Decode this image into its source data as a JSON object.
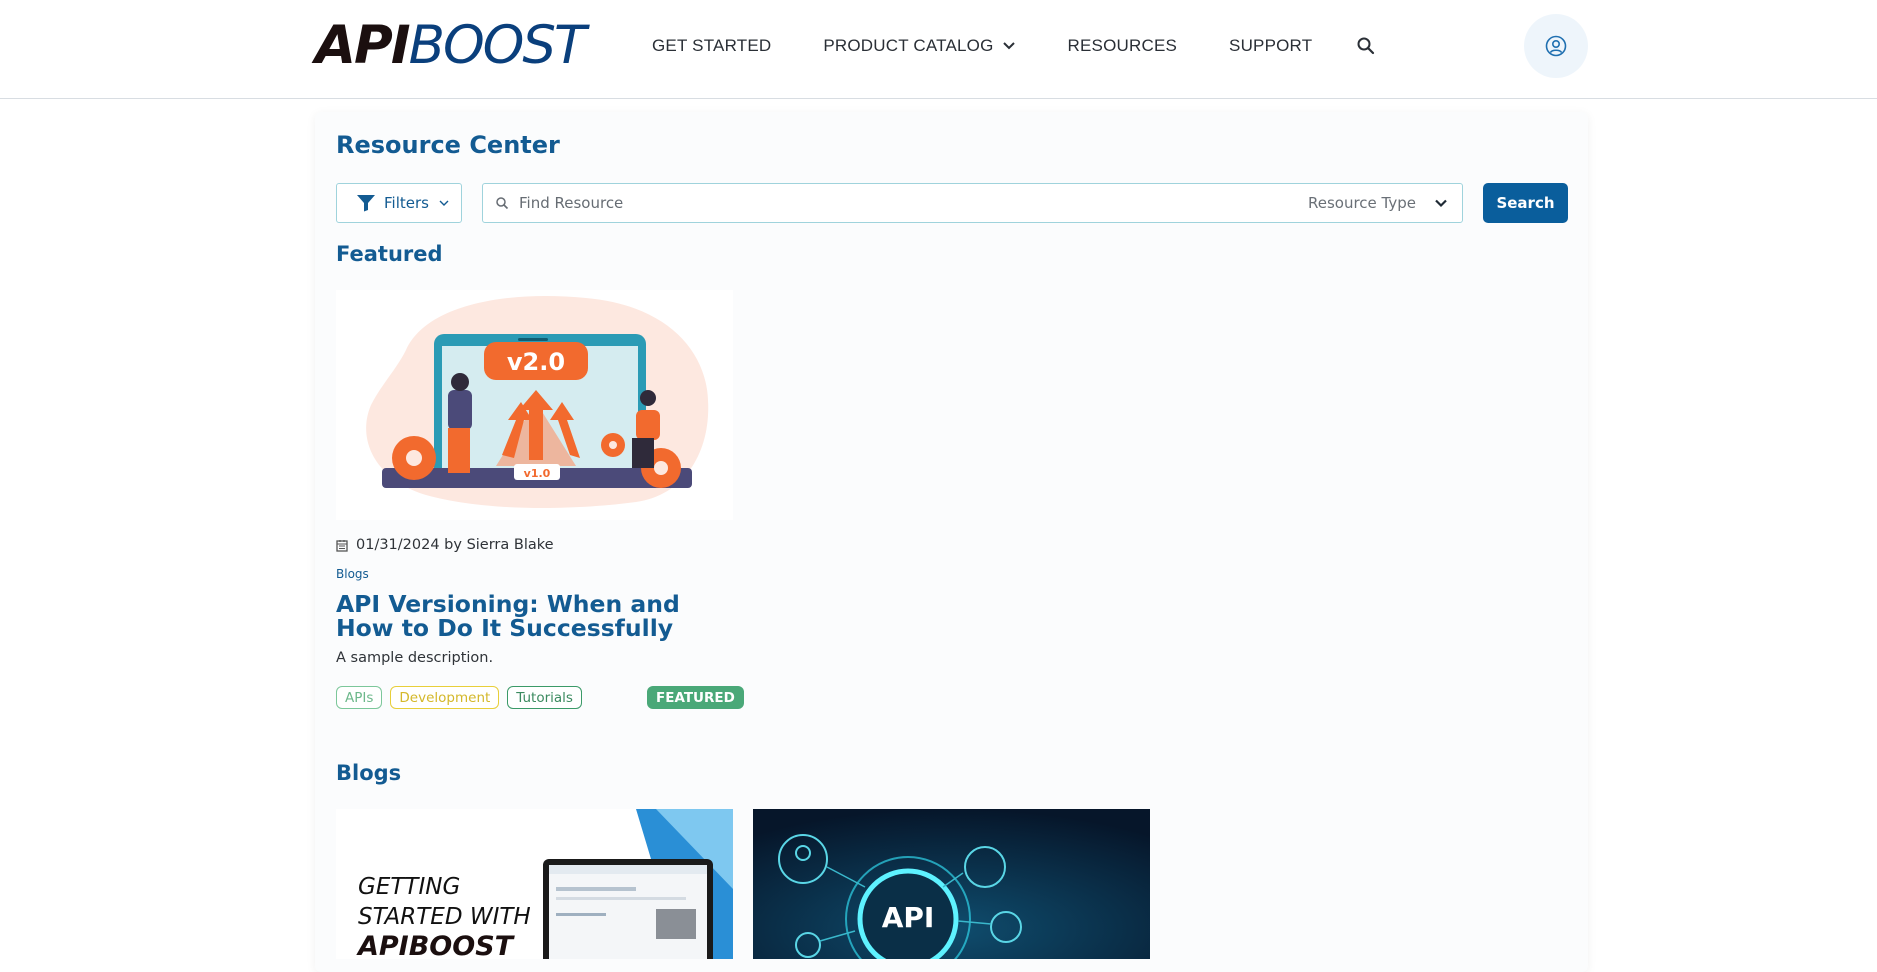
{
  "header": {
    "logo_api": "API",
    "logo_boost": "BOOST",
    "nav": [
      {
        "label": "GET STARTED"
      },
      {
        "label": "PRODUCT CATALOG"
      },
      {
        "label": "RESOURCES"
      },
      {
        "label": "SUPPORT"
      }
    ],
    "icons": {
      "search": "search-icon",
      "profile": "user-circle-icon",
      "dropdown": "chevron-down-icon"
    }
  },
  "main": {
    "title": "Resource Center",
    "filters_label": "Filters",
    "search": {
      "placeholder": "Find Resource",
      "value": ""
    },
    "resource_type_label": "Resource Type",
    "search_button": "Search",
    "featured_heading": "Featured",
    "featured": {
      "image_label_top": "v2.0",
      "image_label_bottom": "v1.0",
      "date_author": "01/31/2024 by Sierra Blake",
      "category": "Blogs",
      "title": "API Versioning: When and How to Do It Successfully",
      "description": "A sample description.",
      "tags": [
        {
          "label": "APIs",
          "color": "#7cc79a"
        },
        {
          "label": "Development",
          "color": "#e8cf3a"
        },
        {
          "label": "Tutorials",
          "color": "#3b9a68"
        }
      ],
      "badge": "FEATURED"
    },
    "blogs_heading": "Blogs",
    "blogs": [
      {
        "image_text_1": "GETTING",
        "image_text_2": "STARTED WITH",
        "image_text_3": "APIBOOST"
      },
      {
        "image_text": "API"
      }
    ]
  },
  "colors": {
    "primary": "#135b92",
    "button": "#0a5e9c",
    "featured_badge": "#4aa878",
    "accent_orange": "#f26a2e"
  }
}
